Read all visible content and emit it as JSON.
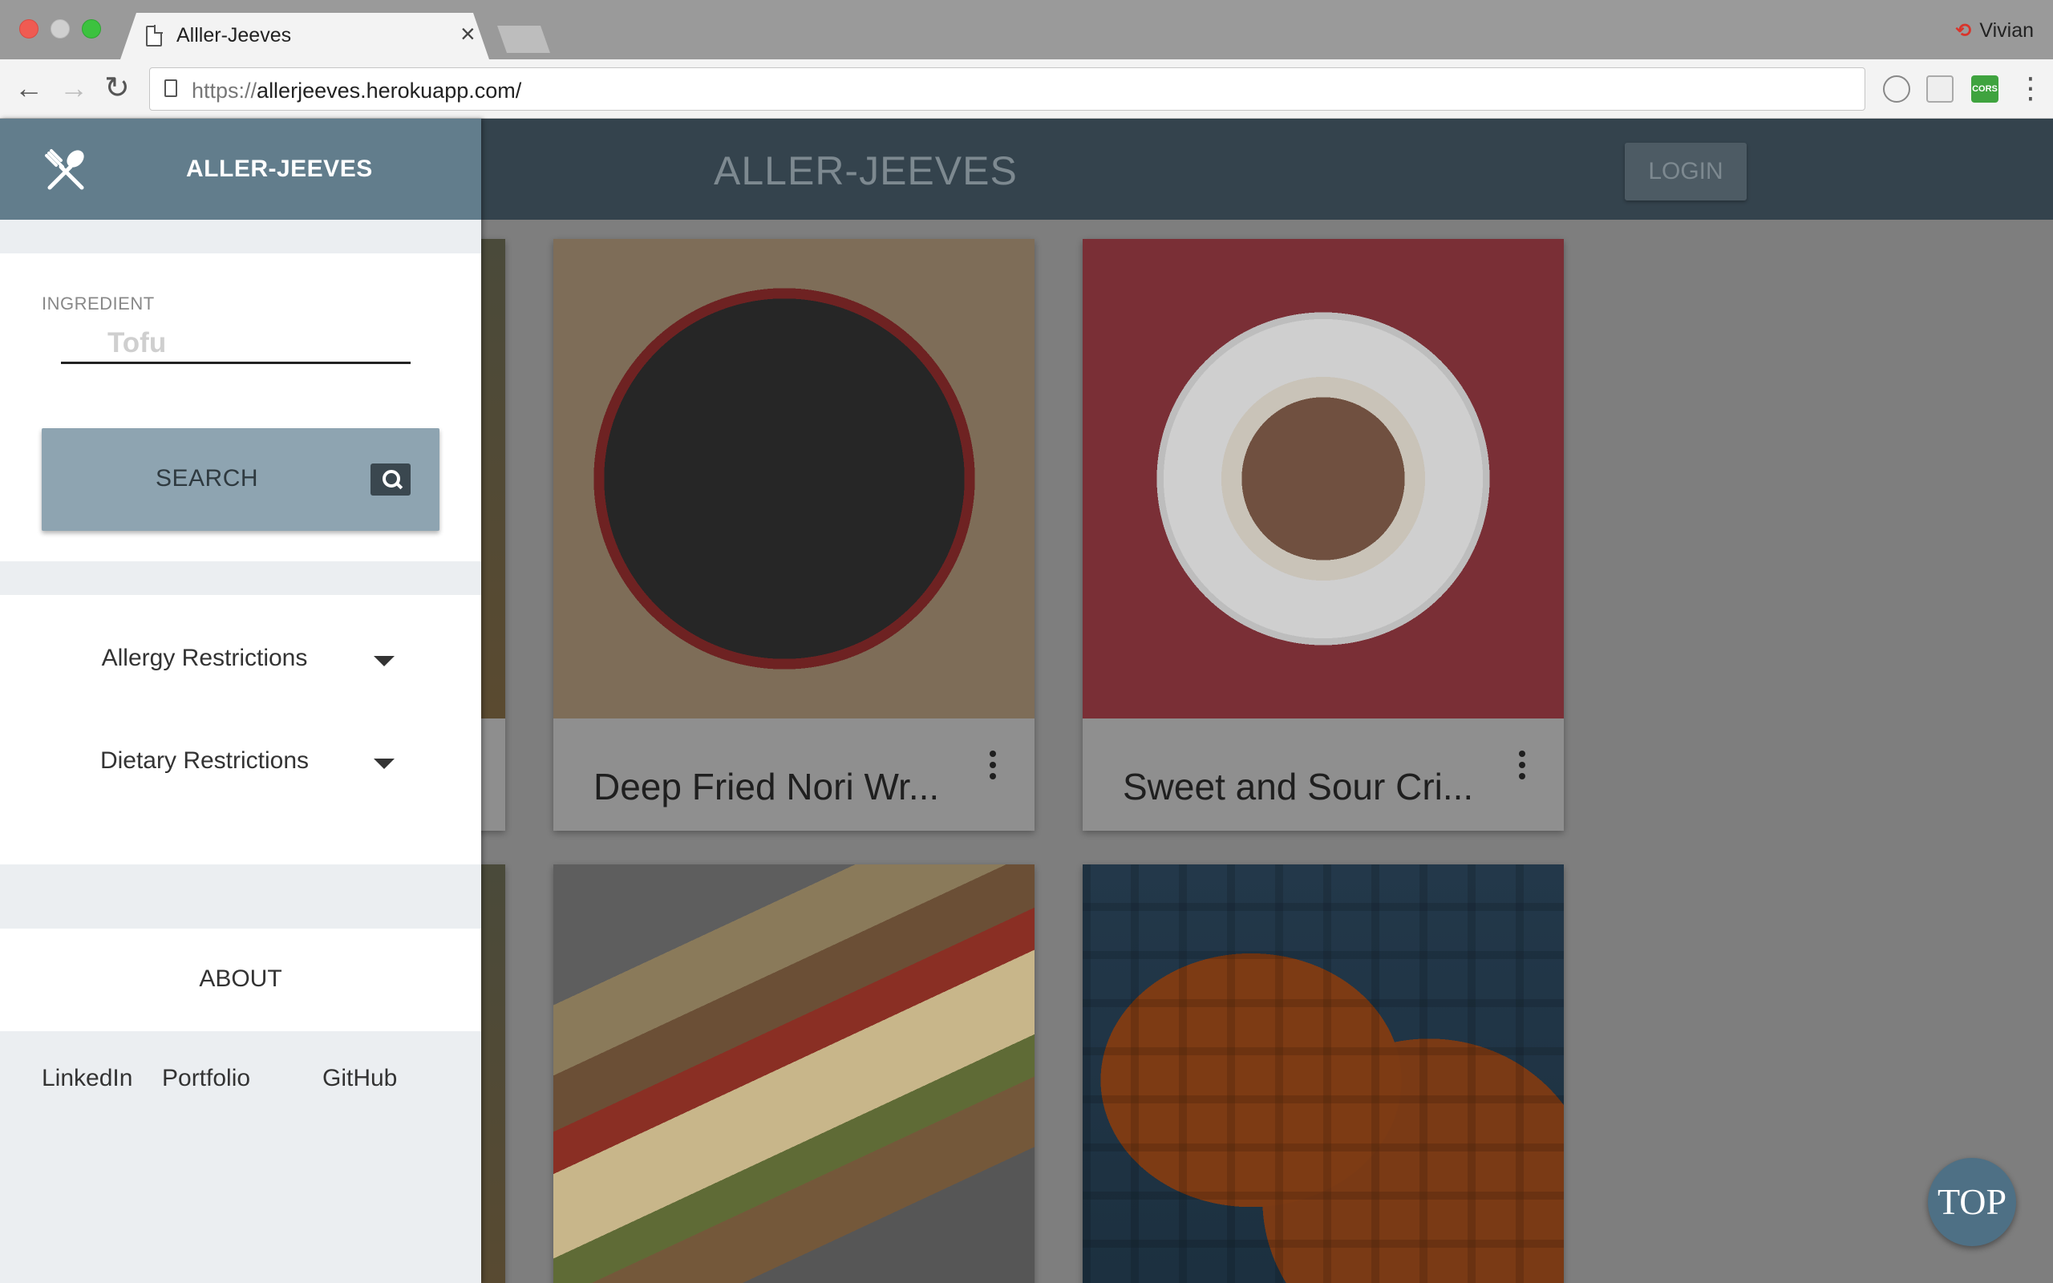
{
  "browser": {
    "tab_title": "Alller-Jeeves",
    "tab_close": "×",
    "profile_name": "Vivian",
    "url_scheme": "https://",
    "url_host": "allerjeeves.herokuapp.com/",
    "ext_cors_label": "CORS"
  },
  "header": {
    "title": "ALLER-JEEVES",
    "login_label": "LOGIN"
  },
  "drawer": {
    "brand": "ALLER-JEEVES",
    "ingredient_label": "INGREDIENT",
    "ingredient_placeholder": "Tofu",
    "search_label": "SEARCH",
    "filters": [
      {
        "label": "Allergy Restrictions"
      },
      {
        "label": "Dietary Restrictions"
      }
    ],
    "about_label": "ABOUT",
    "links": [
      "LinkedIn",
      "Portfolio",
      "GitHub"
    ]
  },
  "recipes": [
    {
      "title": "Deep Fried Nori Wr...",
      "image": "deep-fried-nori-photo"
    },
    {
      "title": "Sweet and Sour Cri...",
      "image": "sweet-and-sour-photo"
    },
    {
      "title": "",
      "image": "grilled-sandwich-photo"
    },
    {
      "title": "",
      "image": "tofu-waffle-photo"
    }
  ],
  "top_button": "TOP",
  "colors": {
    "header_bg": "#34434d",
    "drawer_head_bg": "#627d8c",
    "search_button_bg": "#8ea4b1",
    "top_button_bg": "#4e7085"
  }
}
